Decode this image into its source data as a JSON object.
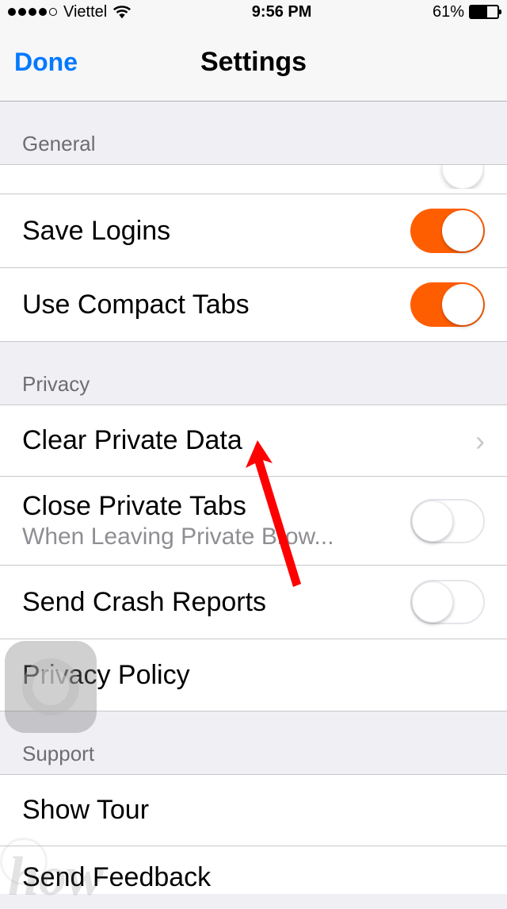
{
  "status_bar": {
    "carrier": "Viettel",
    "time": "9:56 PM",
    "battery_percent": "61%"
  },
  "nav": {
    "done": "Done",
    "title": "Settings"
  },
  "sections": {
    "general": {
      "header": "General",
      "save_logins": "Save Logins",
      "use_compact_tabs": "Use Compact Tabs"
    },
    "privacy": {
      "header": "Privacy",
      "clear_private_data": "Clear Private Data",
      "close_private_tabs": "Close Private Tabs",
      "close_private_tabs_sub": "When Leaving Private Brow...",
      "send_crash_reports": "Send Crash Reports",
      "privacy_policy": "Privacy Policy"
    },
    "support": {
      "header": "Support",
      "show_tour": "Show Tour",
      "send_feedback": "Send Feedback"
    }
  },
  "watermark": "how"
}
